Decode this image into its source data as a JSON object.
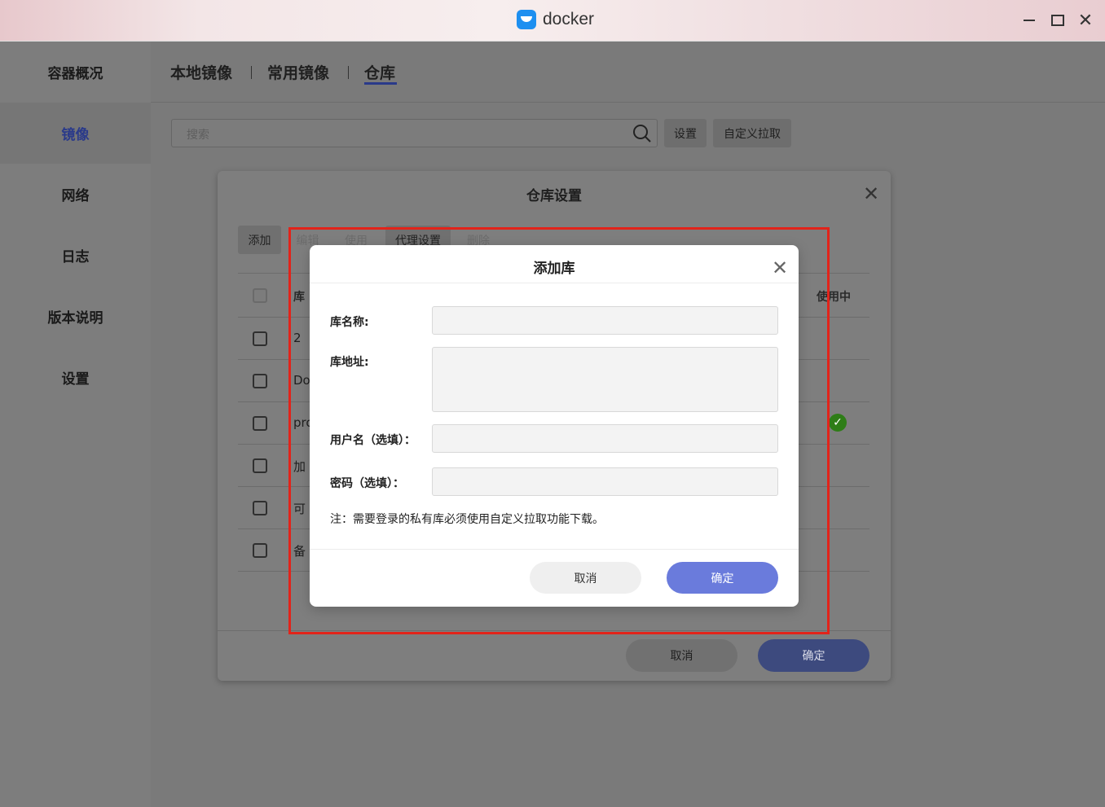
{
  "window": {
    "app_title": "docker"
  },
  "sidebar": {
    "items": [
      {
        "label": "容器概况"
      },
      {
        "label": "镜像"
      },
      {
        "label": "网络"
      },
      {
        "label": "日志"
      },
      {
        "label": "版本说明"
      },
      {
        "label": "设置"
      }
    ],
    "active": "镜像"
  },
  "tabs": [
    {
      "label": "本地镜像"
    },
    {
      "label": "常用镜像"
    },
    {
      "label": "仓库"
    }
  ],
  "toolbar": {
    "search_placeholder": "搜索",
    "settings_label": "设置",
    "custom_pull_label": "自定义拉取"
  },
  "repo_modal": {
    "title": "仓库设置",
    "buttons": {
      "add": "添加",
      "edit": "编辑",
      "use": "使用",
      "proxy": "代理设置",
      "delete": "删除"
    },
    "columns": {
      "repo": "库",
      "in_use": "使用中"
    },
    "rows": [
      {
        "name": "2",
        "in_use": false
      },
      {
        "name": "Do",
        "in_use": false
      },
      {
        "name": "pro",
        "in_use": true
      },
      {
        "name": "加",
        "in_use": false
      },
      {
        "name": "可",
        "in_use": false
      },
      {
        "name": "备",
        "in_use": false
      }
    ],
    "cancel": "取消",
    "confirm": "确定"
  },
  "add_repo_dialog": {
    "title": "添加库",
    "fields": {
      "name_label": "库名称:",
      "url_label": "库地址:",
      "username_label": "用户名（选填）：",
      "password_label": "密码（选填）："
    },
    "note": "注：需要登录的私有库必须使用自定义拉取功能下载。",
    "cancel": "取消",
    "confirm": "确定"
  },
  "colors": {
    "accent": "#6a7bdc",
    "highlight_border": "#e2231a",
    "in_use_check": "#2e7d17"
  }
}
